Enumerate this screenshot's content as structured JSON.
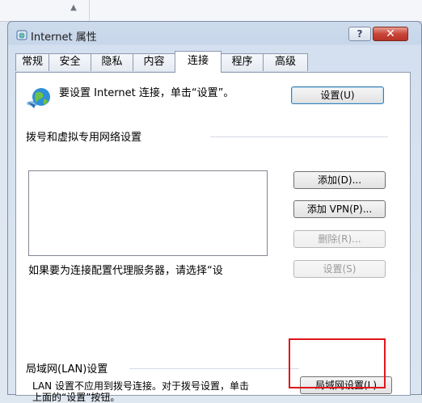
{
  "window": {
    "title": "Internet 属性",
    "help_label": "?",
    "close_label": "✕"
  },
  "tabs": [
    {
      "label": "常规"
    },
    {
      "label": "安全"
    },
    {
      "label": "隐私"
    },
    {
      "label": "内容"
    },
    {
      "label": "连接"
    },
    {
      "label": "程序"
    },
    {
      "label": "高级"
    }
  ],
  "active_tab": "连接",
  "setup": {
    "text": "要设置 Internet 连接，单击“设置”。",
    "button": "设置(U)"
  },
  "dialup": {
    "heading": "拨号和虚拟专用网络设置",
    "add_button": "添加(D)...",
    "add_vpn_button": "添加 VPN(P)...",
    "delete_button": "删除(R)...",
    "settings_button": "设置(S)",
    "proxy_text": "如果要为连接配置代理服务器，请选择“设"
  },
  "lan": {
    "heading": "局域网(LAN)设置",
    "text": "LAN 设置不应用到拨号连接。对于拨号设置，单击上面的“设置”按钮。",
    "button": "局域网设置(L)"
  },
  "colors": {
    "highlight": "#e0161a",
    "close_button": "#c9443a"
  }
}
